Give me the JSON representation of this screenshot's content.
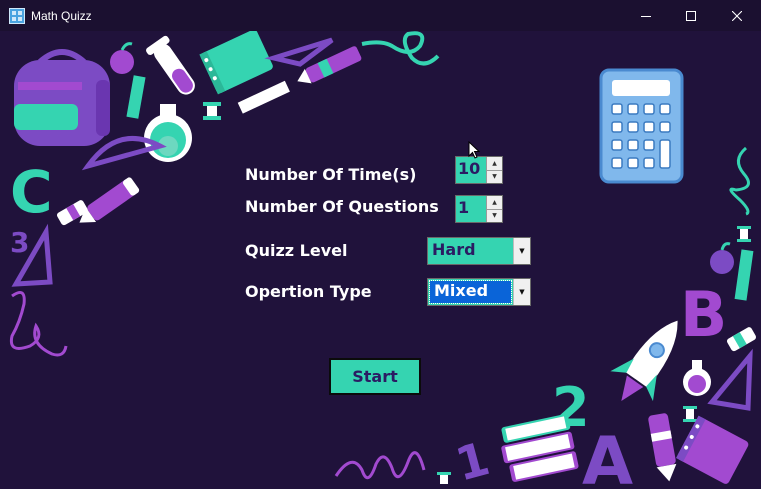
{
  "window": {
    "title": "Math Quizz",
    "minimize_label": "─",
    "maximize_label": "☐",
    "close_label": "✕"
  },
  "form": {
    "time_label": "Number Of Time(s)",
    "time_value": "10",
    "questions_label": "Number Of Questions",
    "questions_value": "1",
    "level_label": "Quizz Level",
    "level_value": "Hard",
    "operation_label": "Opertion Type",
    "operation_value": "Mixed",
    "start_label": "Start"
  },
  "decorations": {
    "letter_c": "C",
    "digit_three": "3",
    "letter_b": "B",
    "digit_two": "2",
    "digit_one": "1",
    "letter_a": "A"
  },
  "colors": {
    "background": "#20123b",
    "titlebar": "#1b1030",
    "accent_teal": "#35d4b1",
    "accent_purple": "#7c4bc4",
    "select_highlight": "#0a64d8",
    "text_dark": "#2b1b63"
  }
}
